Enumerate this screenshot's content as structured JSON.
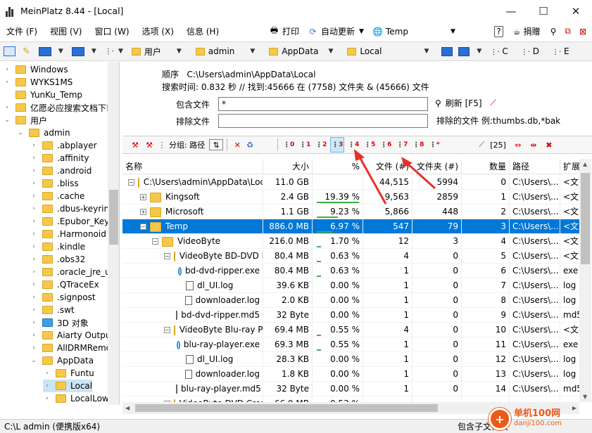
{
  "window": {
    "title": "MeinPlatz 8.44 - [Local]",
    "controls": [
      "—",
      "☐",
      "✕"
    ]
  },
  "menu": {
    "items": [
      "文件 (F)",
      "视图 (V)",
      "窗口 (W)",
      "选项 (X)",
      "信息 (H)"
    ],
    "print": "打印",
    "auto_update": "自动更新",
    "temp_location": "Temp",
    "donate": "捐赠"
  },
  "address": {
    "crumbs": [
      "用户",
      "admin",
      "AppData",
      "Local"
    ],
    "drives": [
      "C",
      "D",
      "E"
    ]
  },
  "tree": {
    "items": [
      {
        "label": "Windows",
        "indent": 0,
        "arrow": "›"
      },
      {
        "label": "WYKS1MS",
        "indent": 0,
        "arrow": "›"
      },
      {
        "label": "YunKu_Temp",
        "indent": 0,
        "arrow": ""
      },
      {
        "label": "亿愿必应搜索文档下载",
        "indent": 0,
        "arrow": "›"
      },
      {
        "label": "用户",
        "indent": 0,
        "arrow": "⌄"
      },
      {
        "label": "admin",
        "indent": 1,
        "arrow": "⌄"
      },
      {
        "label": ".abplayer",
        "indent": 2,
        "arrow": "›"
      },
      {
        "label": ".affinity",
        "indent": 2,
        "arrow": "›"
      },
      {
        "label": ".android",
        "indent": 2,
        "arrow": "›"
      },
      {
        "label": ".bliss",
        "indent": 2,
        "arrow": "›"
      },
      {
        "label": ".cache",
        "indent": 2,
        "arrow": "›"
      },
      {
        "label": ".dbus-keyrings",
        "indent": 2,
        "arrow": "›"
      },
      {
        "label": ".Epubor_KeyFiles",
        "indent": 2,
        "arrow": "›"
      },
      {
        "label": ".Harmonoid",
        "indent": 2,
        "arrow": "›"
      },
      {
        "label": ".kindle",
        "indent": 2,
        "arrow": "›"
      },
      {
        "label": ".obs32",
        "indent": 2,
        "arrow": "›"
      },
      {
        "label": ".oracle_jre_usage",
        "indent": 2,
        "arrow": "›"
      },
      {
        "label": ".QTraceEx",
        "indent": 2,
        "arrow": "›"
      },
      {
        "label": ".signpost",
        "indent": 2,
        "arrow": "›"
      },
      {
        "label": ".swt",
        "indent": 2,
        "arrow": "›"
      },
      {
        "label": "3D 对象",
        "indent": 2,
        "arrow": "›"
      },
      {
        "label": "Aiarty Output",
        "indent": 2,
        "arrow": "›"
      },
      {
        "label": "AllDRMRemoval",
        "indent": 2,
        "arrow": "›"
      },
      {
        "label": "AppData",
        "indent": 2,
        "arrow": "⌄"
      },
      {
        "label": "Funtu",
        "indent": 3,
        "arrow": "›"
      },
      {
        "label": "Local",
        "indent": 3,
        "arrow": "›"
      },
      {
        "label": "LocalLow",
        "indent": 3,
        "arrow": "›"
      }
    ]
  },
  "info": {
    "order_label": "顺序",
    "order_path": "C:\\Users\\admin\\AppData\\Local",
    "search_summary": "搜索时间: 0.832 秒 //  找到:45666 在 (7758) 文件夹 & (45666) 文件"
  },
  "filters": {
    "include_label": "包含文件",
    "include_value": "*",
    "exclude_label": "排除文件",
    "exclude_value": "",
    "refresh_label": "刷新 [F5]",
    "excluded_note": "排除的文件 例:thumbs.db,*bak"
  },
  "toolbar": {
    "group_label": "分组: 路径",
    "levels": [
      "0",
      "1",
      "2",
      "3",
      "4",
      "5",
      "6",
      "7",
      "8",
      "*"
    ],
    "count_label": "[25]"
  },
  "table": {
    "columns": [
      "名称",
      "大小",
      "%",
      "文件 (#)",
      "文件夹 (#)",
      "数量",
      "路径",
      "扩展"
    ],
    "rows": [
      {
        "name": "C:\\Users\\admin\\AppData\\Local",
        "indent": 0,
        "icon": "folder",
        "exp": "−",
        "size": "11.0 GB",
        "pct": "",
        "pctval": 0,
        "files": "44,515",
        "folders": "5994",
        "count": "0",
        "path": "C:\\Users\\...",
        "ext": "<文"
      },
      {
        "name": "Kingsoft",
        "indent": 1,
        "icon": "folder",
        "exp": "+",
        "size": "2.4 GB",
        "pct": "19.39 %",
        "pctval": 19.39,
        "files": "9,563",
        "folders": "2859",
        "count": "1",
        "path": "C:\\Users\\...",
        "ext": "<文"
      },
      {
        "name": "Microsoft",
        "indent": 1,
        "icon": "folder",
        "exp": "+",
        "size": "1.1 GB",
        "pct": "9.23 %",
        "pctval": 9.23,
        "files": "5,866",
        "folders": "448",
        "count": "2",
        "path": "C:\\Users\\...",
        "ext": "<文"
      },
      {
        "name": "Temp",
        "indent": 1,
        "icon": "folder",
        "exp": "−",
        "size": "886.0 MB",
        "pct": "6.97 %",
        "pctval": 6.97,
        "files": "547",
        "folders": "79",
        "count": "3",
        "path": "C:\\Users\\...",
        "ext": "<文",
        "selected": true
      },
      {
        "name": "VideoByte",
        "indent": 2,
        "icon": "folder",
        "exp": "−",
        "size": "216.0 MB",
        "pct": "1.70 %",
        "pctval": 1.7,
        "files": "12",
        "folders": "3",
        "count": "4",
        "path": "C:\\Users\\...",
        "ext": "<文"
      },
      {
        "name": "VideoByte BD-DVD Ripper",
        "indent": 3,
        "icon": "folder",
        "exp": "−",
        "size": "80.4 MB",
        "pct": "0.63 %",
        "pctval": 0.63,
        "files": "4",
        "folders": "0",
        "count": "5",
        "path": "C:\\Users\\...",
        "ext": "<文"
      },
      {
        "name": "bd-dvd-ripper.exe",
        "indent": 4,
        "icon": "exe",
        "exp": "",
        "size": "80.4 MB",
        "pct": "0.63 %",
        "pctval": 0.63,
        "files": "1",
        "folders": "0",
        "count": "6",
        "path": "C:\\Users\\...",
        "ext": "exe"
      },
      {
        "name": "dl_UI.log",
        "indent": 4,
        "icon": "file",
        "exp": "",
        "size": "39.6 KB",
        "pct": "0.00 %",
        "pctval": 0,
        "files": "1",
        "folders": "0",
        "count": "7",
        "path": "C:\\Users\\...",
        "ext": "log"
      },
      {
        "name": "downloader.log",
        "indent": 4,
        "icon": "file",
        "exp": "",
        "size": "2.0 KB",
        "pct": "0.00 %",
        "pctval": 0,
        "files": "1",
        "folders": "0",
        "count": "8",
        "path": "C:\\Users\\...",
        "ext": "log"
      },
      {
        "name": "bd-dvd-ripper.md5",
        "indent": 4,
        "icon": "file",
        "exp": "",
        "size": "32 Byte",
        "pct": "0.00 %",
        "pctval": 0,
        "files": "1",
        "folders": "0",
        "count": "9",
        "path": "C:\\Users\\...",
        "ext": "md5"
      },
      {
        "name": "VideoByte Blu-ray Player",
        "indent": 3,
        "icon": "folder",
        "exp": "−",
        "size": "69.4 MB",
        "pct": "0.55 %",
        "pctval": 0.55,
        "files": "4",
        "folders": "0",
        "count": "10",
        "path": "C:\\Users\\...",
        "ext": "<文"
      },
      {
        "name": "blu-ray-player.exe",
        "indent": 4,
        "icon": "exe",
        "exp": "",
        "size": "69.3 MB",
        "pct": "0.55 %",
        "pctval": 0.55,
        "files": "1",
        "folders": "0",
        "count": "11",
        "path": "C:\\Users\\...",
        "ext": "exe"
      },
      {
        "name": "dl_UI.log",
        "indent": 4,
        "icon": "file",
        "exp": "",
        "size": "28.3 KB",
        "pct": "0.00 %",
        "pctval": 0,
        "files": "1",
        "folders": "0",
        "count": "12",
        "path": "C:\\Users\\...",
        "ext": "log"
      },
      {
        "name": "downloader.log",
        "indent": 4,
        "icon": "file",
        "exp": "",
        "size": "1.8 KB",
        "pct": "0.00 %",
        "pctval": 0,
        "files": "1",
        "folders": "0",
        "count": "13",
        "path": "C:\\Users\\...",
        "ext": "log"
      },
      {
        "name": "blu-ray-player.md5",
        "indent": 4,
        "icon": "file",
        "exp": "",
        "size": "32 Byte",
        "pct": "0.00 %",
        "pctval": 0,
        "files": "1",
        "folders": "0",
        "count": "14",
        "path": "C:\\Users\\...",
        "ext": "md5"
      },
      {
        "name": "VideoByte DVD Creator",
        "indent": 3,
        "icon": "folder",
        "exp": "−",
        "size": "66.9 MB",
        "pct": "0.53 %",
        "pctval": 0.53,
        "files": "",
        "folders": "",
        "count": "",
        "path": "",
        "ext": ""
      }
    ]
  },
  "status": {
    "left": "C:\\L admin (便携版x64)",
    "right": "包含子文件夹"
  },
  "watermark": {
    "main": "单机100网",
    "sub": "danji100.com"
  },
  "colors": {
    "selection": "#0078d7",
    "folder": "#f5c84a",
    "arrow": "#e8302a",
    "pct_bar": "#3cb043"
  }
}
